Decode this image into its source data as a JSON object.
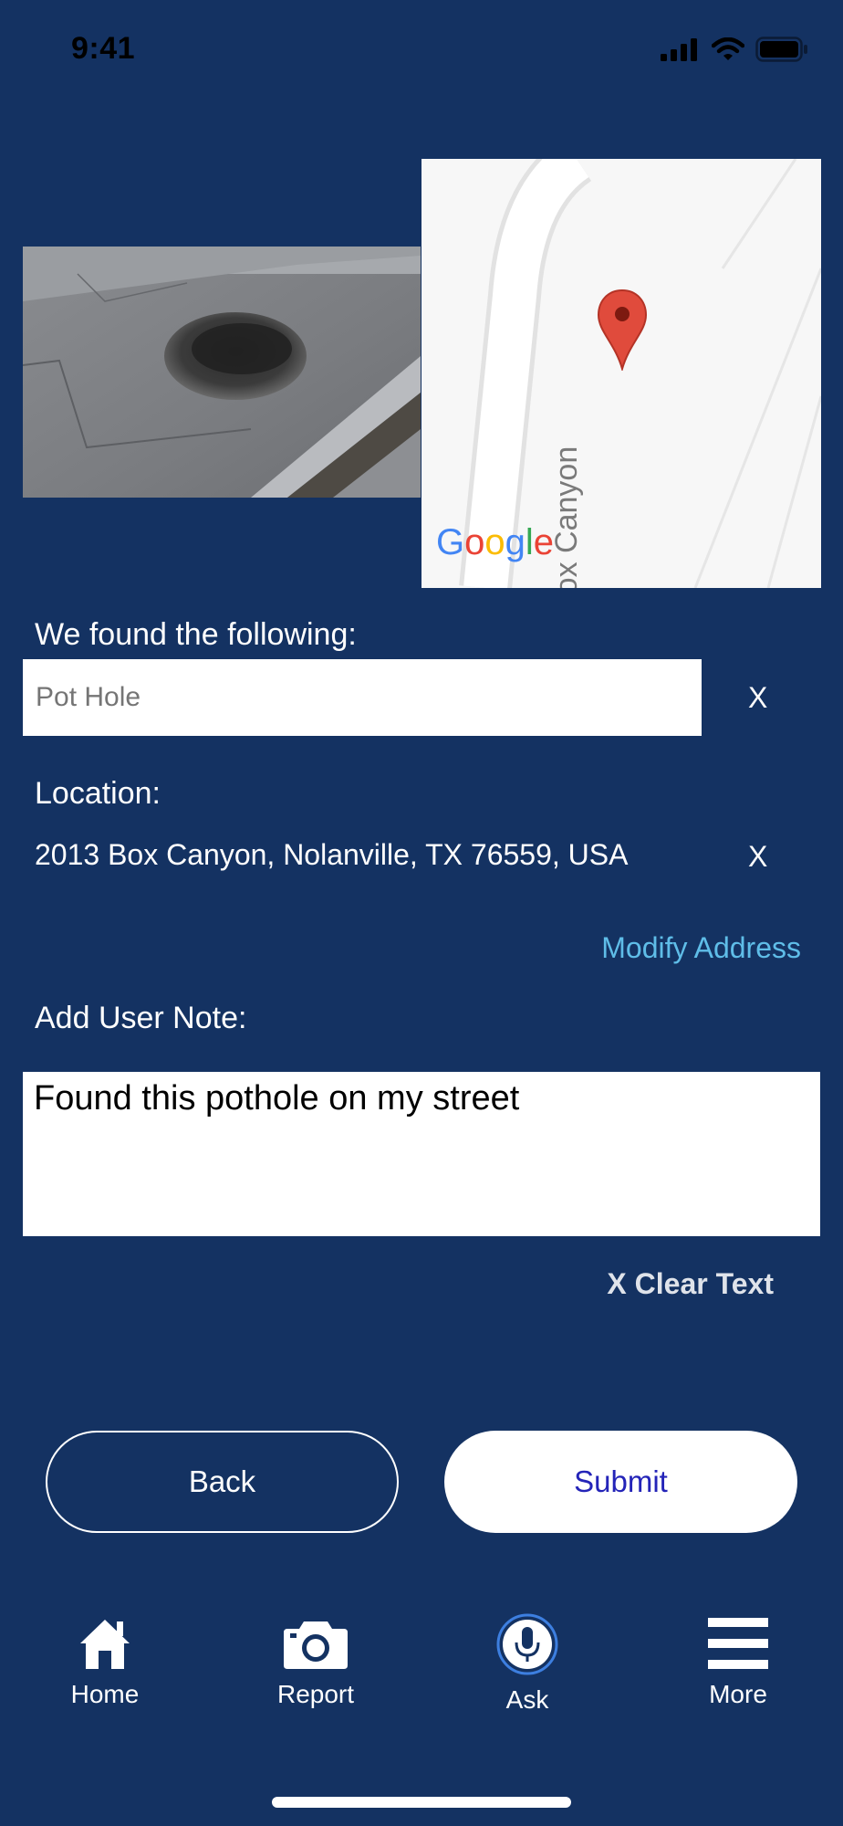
{
  "status_bar": {
    "time": "9:41"
  },
  "map": {
    "street_label": "Box Canyon",
    "attribution": "Google"
  },
  "found": {
    "label": "We found the following:",
    "placeholder": "Pot Hole",
    "clear": "X"
  },
  "location": {
    "label": "Location:",
    "address": "2013 Box Canyon, Nolanville, TX 76559, USA",
    "clear": "X",
    "modify": "Modify Address"
  },
  "note": {
    "label": "Add User Note:",
    "value": "Found this pothole on my street",
    "clear": "X Clear Text"
  },
  "buttons": {
    "back": "Back",
    "submit": "Submit"
  },
  "tabbar": [
    {
      "label": "Home",
      "icon": "house-icon"
    },
    {
      "label": "Report",
      "icon": "camera-icon"
    },
    {
      "label": "Ask",
      "icon": "microphone-icon"
    },
    {
      "label": "More",
      "icon": "hamburger-icon"
    }
  ],
  "colors": {
    "background": "#143262",
    "link": "#5fbde8",
    "submit_text": "#2424b8"
  }
}
